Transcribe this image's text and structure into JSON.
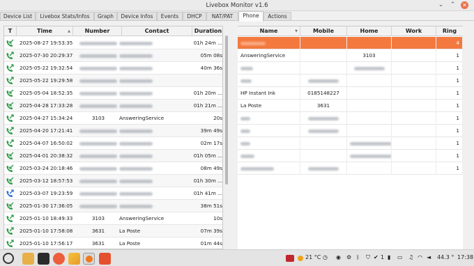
{
  "window": {
    "title": "Livebox Monitor v1.6"
  },
  "tabs": [
    "Device List",
    "Livebox Stats/Infos",
    "Graph",
    "Device Infos",
    "Events",
    "DHCP",
    "NAT/PAT",
    "Phone",
    "Actions"
  ],
  "active_tab": "Phone",
  "calls": {
    "headers": {
      "type": "T",
      "time": "Time",
      "number": "Number",
      "contact": "Contact",
      "duration": "Duration"
    },
    "rows": [
      {
        "icon": "incoming-call-icon",
        "time": "2025-08-27 19:53:35",
        "number": "",
        "contact": "",
        "duration": "01h 24m ..."
      },
      {
        "icon": "outgoing-call-icon",
        "time": "2025-07-30 20:29:37",
        "number": "",
        "contact": "",
        "duration": "05m 08s"
      },
      {
        "icon": "outgoing-call-icon",
        "time": "2025-05-22 19:32:54",
        "number": "",
        "contact": "",
        "duration": "40m 36s"
      },
      {
        "icon": "outgoing-call-icon",
        "time": "2025-05-22 19:29:58",
        "number": "",
        "contact": "",
        "duration": ""
      },
      {
        "icon": "incoming-call-icon",
        "time": "2025-05-04 18:52:35",
        "number": "",
        "contact": "",
        "duration": "01h 20m ..."
      },
      {
        "icon": "incoming-call-icon",
        "time": "2025-04-28 17:33:28",
        "number": "",
        "contact": "",
        "duration": "01h 21m ..."
      },
      {
        "icon": "outgoing-call-icon",
        "time": "2025-04-27 15:34:24",
        "number": "3103",
        "contact": "AnsweringService",
        "duration": "20s"
      },
      {
        "icon": "outgoing-call-icon",
        "time": "2025-04-20 17:21:41",
        "number": "",
        "contact": "",
        "duration": "39m 49s"
      },
      {
        "icon": "outgoing-call-icon",
        "time": "2025-04-07 16:50:02",
        "number": "",
        "contact": "",
        "duration": "02m 17s"
      },
      {
        "icon": "incoming-call-icon",
        "time": "2025-04-01 20:38:32",
        "number": "",
        "contact": "",
        "duration": "01h 05m ..."
      },
      {
        "icon": "incoming-call-icon",
        "time": "2025-03-24 20:18:46",
        "number": "",
        "contact": "",
        "duration": "08m 49s"
      },
      {
        "icon": "incoming-call-icon",
        "time": "2025-03-12 18:57:53",
        "number": "",
        "contact": "",
        "duration": "01h 30m ..."
      },
      {
        "icon": "missed-call-icon",
        "time": "2025-03-07 19:23:59",
        "number": "",
        "contact": "",
        "duration": "01h 41m ..."
      },
      {
        "icon": "incoming-call-icon",
        "time": "2025-01-30 17:36:05",
        "number": "",
        "contact": "",
        "duration": "38m 51s"
      },
      {
        "icon": "outgoing-call-icon",
        "time": "2025-01-10 18:49:33",
        "number": "3103",
        "contact": "AnsweringService",
        "duration": "10s"
      },
      {
        "icon": "outgoing-call-icon",
        "time": "2025-01-10 17:58:08",
        "number": "3631",
        "contact": "La Poste",
        "duration": "07m 39s"
      },
      {
        "icon": "outgoing-call-icon",
        "time": "2025-01-10 17:56:17",
        "number": "3631",
        "contact": "La Poste",
        "duration": "01m 44s"
      }
    ]
  },
  "contacts": {
    "headers": {
      "name": "Name",
      "mobile": "Mobile",
      "home": "Home",
      "work": "Work",
      "ring": "Ring"
    },
    "rows": [
      {
        "name": "",
        "mobile": "",
        "home": "",
        "work": "",
        "ring": "4"
      },
      {
        "name": "AnsweringService",
        "mobile": "",
        "home": "3103",
        "work": "",
        "ring": "1"
      },
      {
        "name": "",
        "mobile": "",
        "home": "",
        "work": "",
        "ring": "1"
      },
      {
        "name": "",
        "mobile": "",
        "home": "",
        "work": "",
        "ring": "1"
      },
      {
        "name": "HP Instant Ink",
        "mobile": "0185148227",
        "home": "",
        "work": "",
        "ring": "1"
      },
      {
        "name": "La Poste",
        "mobile": "3631",
        "home": "",
        "work": "",
        "ring": "1"
      },
      {
        "name": "",
        "mobile": "",
        "home": "",
        "work": "",
        "ring": "1"
      },
      {
        "name": "",
        "mobile": "",
        "home": "",
        "work": "",
        "ring": "1"
      },
      {
        "name": "",
        "mobile": "",
        "home": "",
        "work": "",
        "ring": "1"
      },
      {
        "name": "",
        "mobile": "",
        "home": "",
        "work": "",
        "ring": "1"
      },
      {
        "name": "",
        "mobile": "",
        "home": "",
        "work": "",
        "ring": "1"
      }
    ]
  },
  "taskbar": {
    "temperature": "21 °C",
    "battery_count": "1",
    "cpu": "44.3 °",
    "clock": "17:38"
  },
  "colors": {
    "selection": "#f4793f",
    "accent": "#e8734d"
  }
}
